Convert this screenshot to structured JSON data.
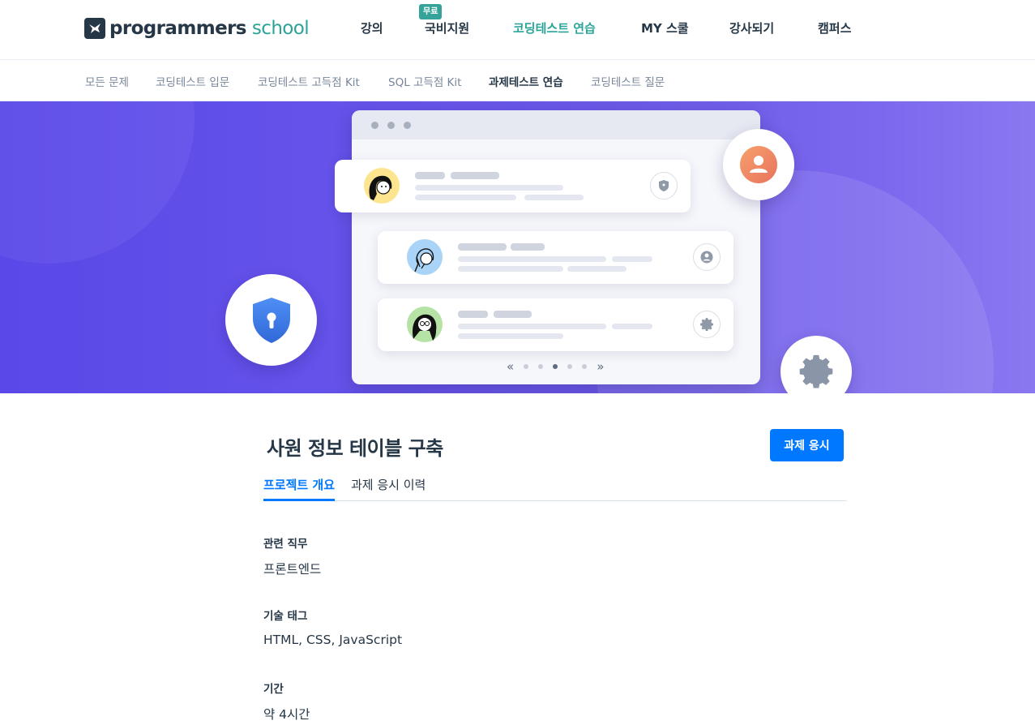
{
  "brand": {
    "name_bold": "programmers",
    "name_light": "school"
  },
  "gnb": {
    "badge": "무료",
    "items": [
      {
        "label": "강의"
      },
      {
        "label": "국비지원"
      },
      {
        "label": "코딩테스트 연습"
      },
      {
        "label": "MY 스쿨"
      },
      {
        "label": "강사되기"
      },
      {
        "label": "캠퍼스"
      }
    ],
    "active_index": 2
  },
  "subnav": {
    "items": [
      {
        "label": "모든 문제"
      },
      {
        "label": "코딩테스트 입문"
      },
      {
        "label": "코딩테스트 고득점 Kit"
      },
      {
        "label": "SQL 고득점 Kit"
      },
      {
        "label": "과제테스트 연습"
      },
      {
        "label": "코딩테스트 질문"
      }
    ],
    "active_index": 4
  },
  "hero": {
    "carousel_pages": 5,
    "carousel_active": 3,
    "prev_glyph": "«",
    "next_glyph": "»",
    "colors": {
      "gradient_start": "#5a48e8",
      "gradient_end": "#8a78f0"
    }
  },
  "assignment": {
    "title": "사원 정보 테이블 구축",
    "apply_label": "과제 응시",
    "tabs": [
      {
        "label": "프로젝트 개요"
      },
      {
        "label": "과제 응시 이력"
      }
    ],
    "active_tab": 0,
    "fields": [
      {
        "label": "관련 직무",
        "value": "프론트엔드"
      },
      {
        "label": "기술 태그",
        "value": "HTML, CSS, JavaScript"
      },
      {
        "label": "기간",
        "value": "약 4시간"
      }
    ]
  },
  "colors": {
    "accent": "#0078ff",
    "brand_teal": "#2ba498",
    "text": "#263747"
  }
}
